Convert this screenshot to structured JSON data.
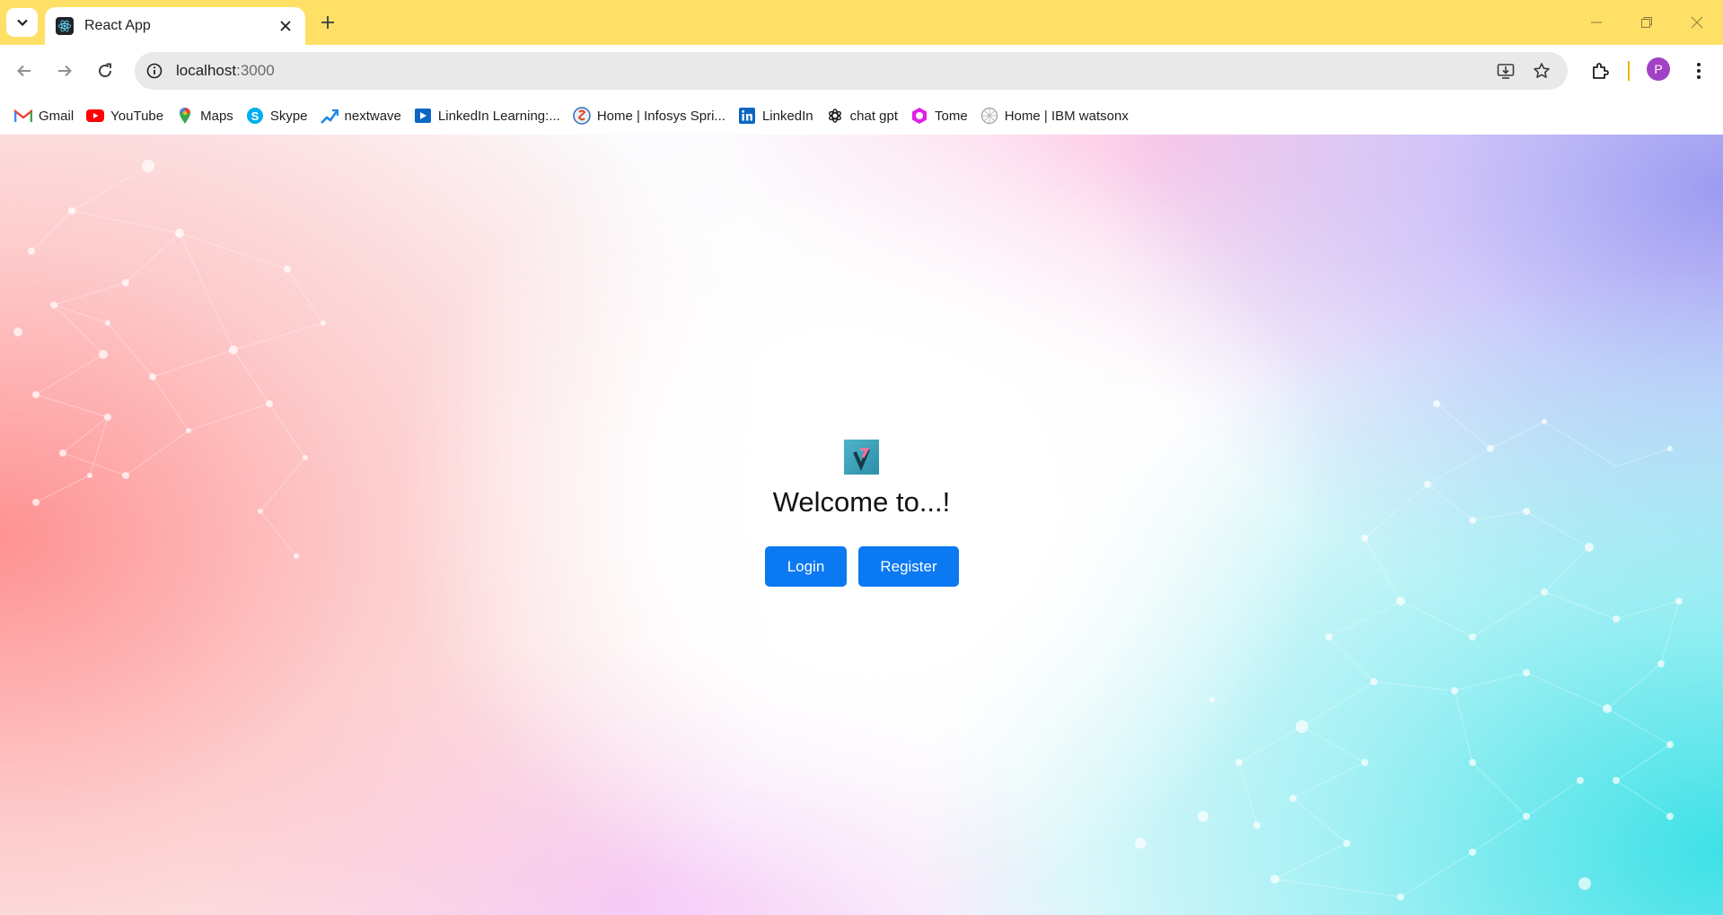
{
  "browser": {
    "tab": {
      "title": "React App"
    },
    "address": {
      "host": "localhost",
      "port": ":3000"
    },
    "profile_initial": "P",
    "bookmarks": [
      {
        "label": "Gmail",
        "icon": "gmail-icon"
      },
      {
        "label": "YouTube",
        "icon": "youtube-icon"
      },
      {
        "label": "Maps",
        "icon": "maps-icon"
      },
      {
        "label": "Skype",
        "icon": "skype-icon"
      },
      {
        "label": "nextwave",
        "icon": "nextwave-icon"
      },
      {
        "label": "LinkedIn Learning:...",
        "icon": "linkedin-learning-icon"
      },
      {
        "label": "Home | Infosys Spri...",
        "icon": "infosys-icon"
      },
      {
        "label": "LinkedIn",
        "icon": "linkedin-icon"
      },
      {
        "label": "chat gpt",
        "icon": "chatgpt-icon"
      },
      {
        "label": "Tome",
        "icon": "tome-icon"
      },
      {
        "label": "Home | IBM watsonx",
        "icon": "ibm-watsonx-icon"
      }
    ]
  },
  "page": {
    "heading": "Welcome to...!",
    "login_label": "Login",
    "register_label": "Register"
  },
  "colors": {
    "tabstrip": "#ffe066",
    "primary_button": "#0a79f2",
    "avatar": "#a142c4"
  }
}
